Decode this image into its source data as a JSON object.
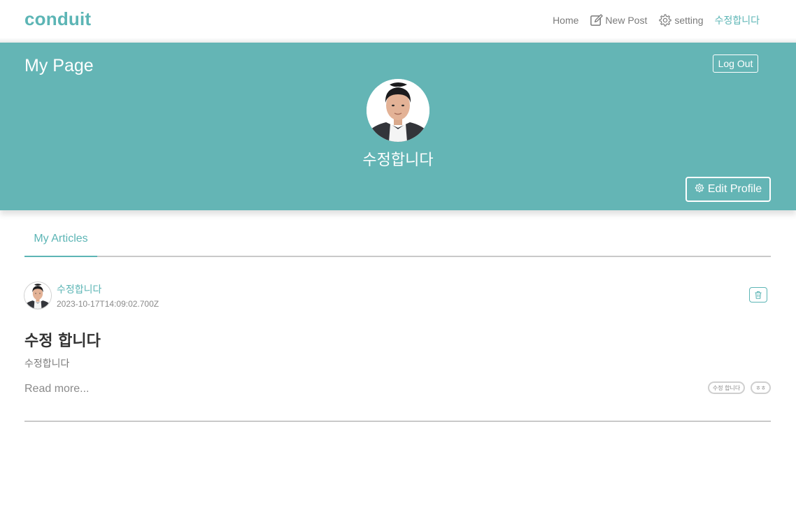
{
  "header": {
    "brand": "conduit",
    "nav": {
      "home": "Home",
      "new_post": "New Post",
      "setting": "setting",
      "user": "수정합니다"
    }
  },
  "banner": {
    "page_title": "My Page",
    "logout_label": "Log Out",
    "username": "수정합니다",
    "edit_profile_label": "Edit Profile"
  },
  "tabs": [
    {
      "label": "My Articles",
      "active": true
    }
  ],
  "articles": [
    {
      "author": "수정합니다",
      "date": "2023-10-17T14:09:02.700Z",
      "title": "수정 합니다",
      "description": "수정합니다",
      "read_more": "Read more...",
      "tags": [
        "수정 합니다",
        "ㅎㅎ"
      ]
    }
  ],
  "colors": {
    "brand": "#5cb5b5",
    "banner": "#64b5b5"
  },
  "icons": {
    "new_post": "edit-icon",
    "setting": "gear-icon",
    "edit_profile": "gear-icon",
    "delete": "trash-icon"
  }
}
